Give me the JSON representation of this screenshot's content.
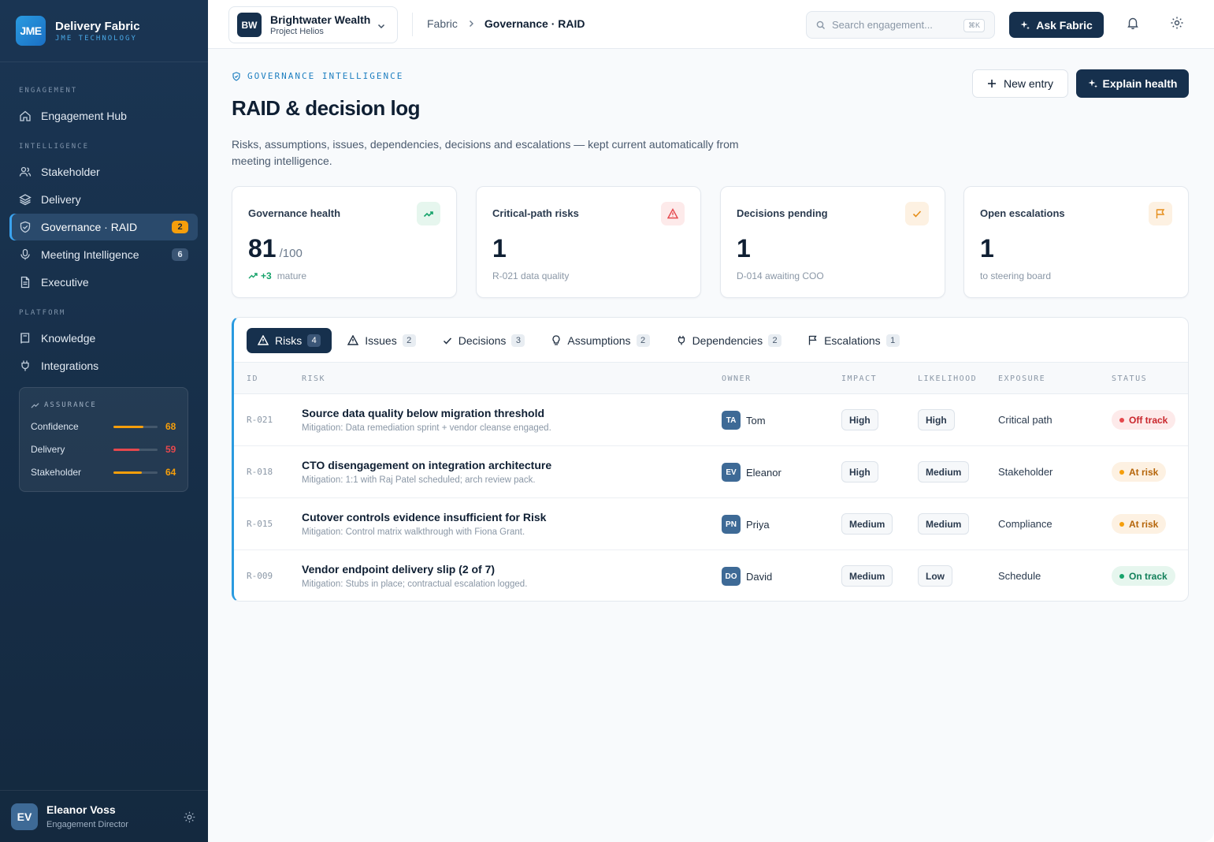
{
  "brand": {
    "logo": "JME",
    "name": "Delivery Fabric",
    "sub": "JME TECHNOLOGY"
  },
  "sidebar": {
    "sections": [
      "ENGAGEMENT",
      "INTELLIGENCE",
      "PLATFORM"
    ],
    "items": [
      {
        "label": "Engagement Hub",
        "icon": "home-icon"
      },
      {
        "label": "Stakeholder",
        "icon": "users-icon"
      },
      {
        "label": "Delivery",
        "icon": "layers-icon"
      },
      {
        "label": "Governance · RAID",
        "icon": "shield-icon",
        "count": "2",
        "active": true
      },
      {
        "label": "Meeting Intelligence",
        "icon": "mic-icon",
        "count": "6"
      },
      {
        "label": "Executive",
        "icon": "document-icon"
      },
      {
        "label": "Knowledge",
        "icon": "book-icon"
      },
      {
        "label": "Integrations",
        "icon": "plug-icon"
      }
    ],
    "assurance": {
      "title": "ASSURANCE",
      "rows": [
        {
          "label": "Confidence",
          "value": "68",
          "level": 0.68,
          "color": "#f59e0b"
        },
        {
          "label": "Delivery",
          "value": "59",
          "level": 0.59,
          "color": "#e5484d"
        },
        {
          "label": "Stakeholder",
          "value": "64",
          "level": 0.64,
          "color": "#f59e0b"
        }
      ]
    },
    "user": {
      "initials": "EV",
      "name": "Eleanor Voss",
      "role": "Engagement Director"
    }
  },
  "topbar": {
    "engagement": {
      "badge": "BW",
      "name": "Brightwater Wealth",
      "project": "Project Helios"
    },
    "breadcrumb": {
      "parent": "Fabric",
      "current": "Governance · RAID"
    },
    "search": {
      "placeholder": "Search engagement...",
      "shortcut": "⌘K"
    },
    "ask_label": "Ask Fabric"
  },
  "page": {
    "eyebrow": "GOVERNANCE INTELLIGENCE",
    "title": "RAID & decision log",
    "description": "Risks, assumptions, issues, dependencies, decisions and escalations — kept current automatically from meeting intelligence.",
    "new_entry_label": "New entry",
    "explain_label": "Explain health"
  },
  "kpis": [
    {
      "label": "Governance health",
      "value": "81",
      "suffix": "/100",
      "delta": "+3",
      "note": "mature",
      "icon": "trend-icon",
      "tint": "#e6f6ee",
      "color": "#17a36b"
    },
    {
      "label": "Critical-path risks",
      "value": "1",
      "note": "R-021 data quality",
      "icon": "warning-icon",
      "tint": "#fdeaea",
      "color": "#e5484d"
    },
    {
      "label": "Decisions pending",
      "value": "1",
      "note": "D-014 awaiting COO",
      "icon": "check-icon",
      "tint": "#fdf1e2",
      "color": "#e58e1a"
    },
    {
      "label": "Open escalations",
      "value": "1",
      "note": "to steering board",
      "icon": "flag-icon",
      "tint": "#fdf1e2",
      "color": "#e58e1a"
    }
  ],
  "tabs": [
    {
      "label": "Risks",
      "count": "4",
      "icon": "warning-icon",
      "active": true
    },
    {
      "label": "Issues",
      "count": "2",
      "icon": "warning-icon"
    },
    {
      "label": "Decisions",
      "count": "3",
      "icon": "check-icon"
    },
    {
      "label": "Assumptions",
      "count": "2",
      "icon": "bulb-icon"
    },
    {
      "label": "Dependencies",
      "count": "2",
      "icon": "plug-icon"
    },
    {
      "label": "Escalations",
      "count": "1",
      "icon": "flag-icon"
    }
  ],
  "table": {
    "headers": [
      "ID",
      "RISK",
      "OWNER",
      "IMPACT",
      "LIKELIHOOD",
      "EXPOSURE",
      "STATUS"
    ],
    "rows": [
      {
        "id": "R-021",
        "title": "Source data quality below migration threshold",
        "mitigation": "Mitigation: Data remediation sprint + vendor cleanse engaged.",
        "owner_initials": "TA",
        "owner": "Tom",
        "impact": "High",
        "likelihood": "High",
        "exposure": "Critical path",
        "status": "Off track",
        "status_kind": "off"
      },
      {
        "id": "R-018",
        "title": "CTO disengagement on integration architecture",
        "mitigation": "Mitigation: 1:1 with Raj Patel scheduled; arch review pack.",
        "owner_initials": "EV",
        "owner": "Eleanor",
        "impact": "High",
        "likelihood": "Medium",
        "exposure": "Stakeholder",
        "status": "At risk",
        "status_kind": "risk"
      },
      {
        "id": "R-015",
        "title": "Cutover controls evidence insufficient for Risk",
        "mitigation": "Mitigation: Control matrix walkthrough with Fiona Grant.",
        "owner_initials": "PN",
        "owner": "Priya",
        "impact": "Medium",
        "likelihood": "Medium",
        "exposure": "Compliance",
        "status": "At risk",
        "status_kind": "risk"
      },
      {
        "id": "R-009",
        "title": "Vendor endpoint delivery slip (2 of 7)",
        "mitigation": "Mitigation: Stubs in place; contractual escalation logged.",
        "owner_initials": "DO",
        "owner": "David",
        "impact": "Medium",
        "likelihood": "Low",
        "exposure": "Schedule",
        "status": "On track",
        "status_kind": "on"
      }
    ]
  }
}
